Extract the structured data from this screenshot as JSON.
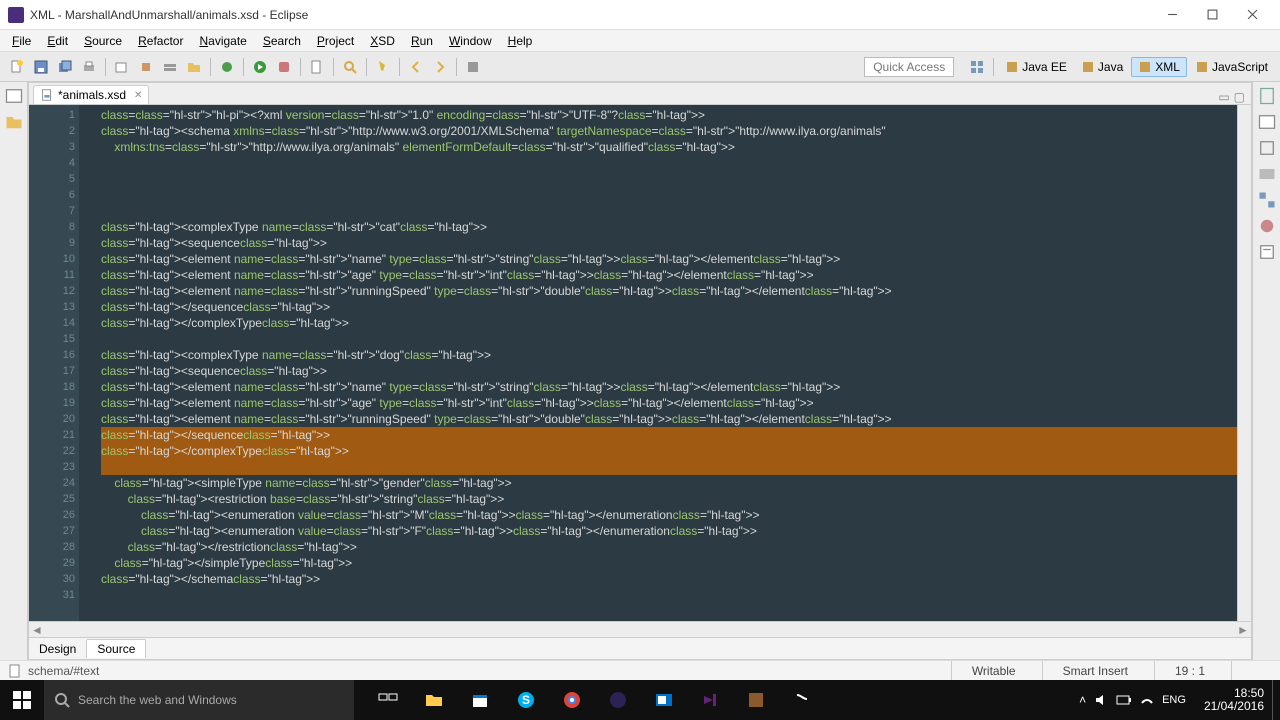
{
  "window": {
    "title": "XML - MarshallAndUnmarshall/animals.xsd - Eclipse",
    "controls": {
      "min": "—",
      "max": "▢",
      "close": "✕"
    }
  },
  "menu": [
    "File",
    "Edit",
    "Source",
    "Refactor",
    "Navigate",
    "Search",
    "Project",
    "XSD",
    "Run",
    "Window",
    "Help"
  ],
  "toolbar": {
    "quick_access": "Quick Access",
    "perspectives": [
      {
        "label": "Java EE",
        "icon": "javaee-icon"
      },
      {
        "label": "Java",
        "icon": "java-icon"
      },
      {
        "label": "XML",
        "icon": "xml-icon",
        "active": true
      },
      {
        "label": "JavaScript",
        "icon": "js-icon"
      }
    ]
  },
  "editor": {
    "tab_label": "*animals.xsd",
    "bottom_tabs": {
      "design": "Design",
      "source": "Source",
      "active": "source"
    },
    "highlighted_lines": [
      21,
      22,
      23
    ],
    "lines": [
      "<?xml version=\"1.0\" encoding=\"UTF-8\"?>",
      "<schema xmlns=\"http://www.w3.org/2001/XMLSchema\" targetNamespace=\"http://www.ilya.org/animals\"",
      "    xmlns:tns=\"http://www.ilya.org/animals\" elementFormDefault=\"qualified\">",
      "",
      "",
      "",
      "",
      "<complexType name=\"cat\">",
      "<sequence>",
      "<element name=\"name\" type=\"string\"></element>",
      "<element name=\"age\" type=\"int\"></element>",
      "<element name=\"runningSpeed\" type=\"double\"></element>",
      "</sequence>",
      "</complexType>",
      "",
      "<complexType name=\"dog\">",
      "<sequence>",
      "<element name=\"name\" type=\"string\"></element>",
      "<element name=\"age\" type=\"int\"></element>",
      "<element name=\"runningSpeed\" type=\"double\"></element>",
      "</sequence>",
      "</complexType>",
      "",
      "    <simpleType name=\"gender\">",
      "        <restriction base=\"string\">",
      "            <enumeration value=\"M\"></enumeration>",
      "            <enumeration value=\"F\"></enumeration>",
      "        </restriction>",
      "    </simpleType>",
      "</schema>",
      ""
    ]
  },
  "status": {
    "path": "schema/#text",
    "writable": "Writable",
    "insert": "Smart Insert",
    "cursor": "19 : 1"
  },
  "taskbar": {
    "search_placeholder": "Search the web and Windows",
    "tray": {
      "lang": "ENG",
      "time": "18:50",
      "date": "21/04/2016"
    }
  }
}
